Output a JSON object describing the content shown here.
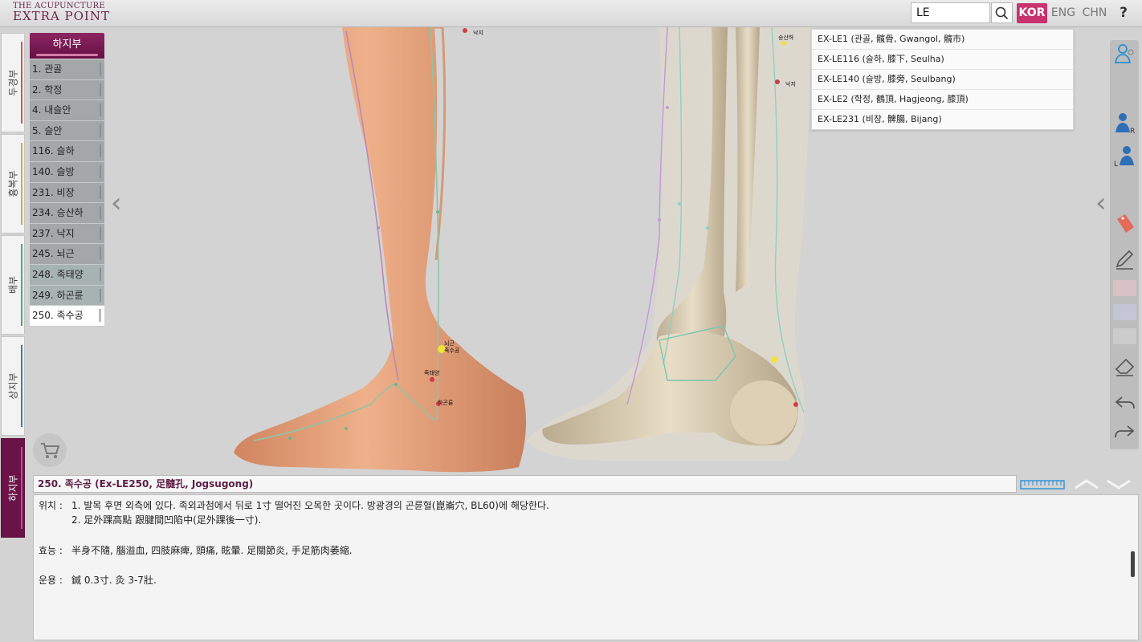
{
  "app": {
    "logo_line1": "THE ACUPUNCTURE",
    "logo_line2": "EXTRA POINT"
  },
  "search": {
    "value": "LE",
    "results": [
      "EX-LE1 (관골, 髖骨, Gwangol, 髖市)",
      "EX-LE116 (슬하, 膝下, Seulha)",
      "EX-LE140 (슬방, 膝旁, Seulbang)",
      "EX-LE2 (학정, 鶴頂, Hagjeong, 膝頂)",
      "EX-LE231 (비장, 髀腸, Bijang)"
    ]
  },
  "languages": [
    {
      "label": "KOR",
      "active": true
    },
    {
      "label": "ENG",
      "active": false
    },
    {
      "label": "CHN",
      "active": false
    }
  ],
  "help_label": "?",
  "region_tabs": [
    {
      "label": "두경부",
      "color": "#d9534f"
    },
    {
      "label": "흉복부",
      "color": "#e8a33c"
    },
    {
      "label": "배부",
      "color": "#3cb371"
    },
    {
      "label": "상지부",
      "color": "#3a78c8"
    },
    {
      "label": "하지부",
      "color": "#c04a9a"
    }
  ],
  "points_list": {
    "header": "하지부",
    "items": [
      "1. 관골",
      "2. 학정",
      "4. 내슬안",
      "5. 슬안",
      "116. 슬하",
      "140. 슬방",
      "231. 비장",
      "234. 승산하",
      "237. 낙지",
      "245. 뇌근",
      "248. 족태양",
      "249. 하곤륜",
      "250. 족수공"
    ]
  },
  "figure_labels": {
    "nakji": "낙지",
    "nwegeun": "뇌근",
    "joksugong": "족수공",
    "joktaeyang": "족태양",
    "hagonryun": "하곤륜",
    "seungsan": "승산하",
    "nakji2": "낙지"
  },
  "point_detail": {
    "title": "250. 족수공 (Ex-LE250, 足髓孔, Jogsugong)",
    "location_label": "위치 :",
    "location_1": "1. 발목 후면 외측에 있다. 족외과첨에서 뒤로 1寸 떨어진 오목한 곳이다. 방광경의 곤륜혈(崑崙穴, BL60)에 해당한다.",
    "location_2": "2. 足外踝高點 跟腱間凹陷中(足外踝後一寸).",
    "effect_label": "효능 :",
    "effect": "半身不隨, 腦溢血, 四肢麻痺, 頭痛, 眩暈. 足關節炎, 手足筋肉萎縮.",
    "usage_label": "운용 :",
    "usage": "鍼 0.3寸. 灸 3-7壯."
  },
  "colors": {
    "accent": "#c8336e",
    "header_purple": "#6b1248",
    "skin": "#e7a27a",
    "bone": "#d9ccb2"
  }
}
